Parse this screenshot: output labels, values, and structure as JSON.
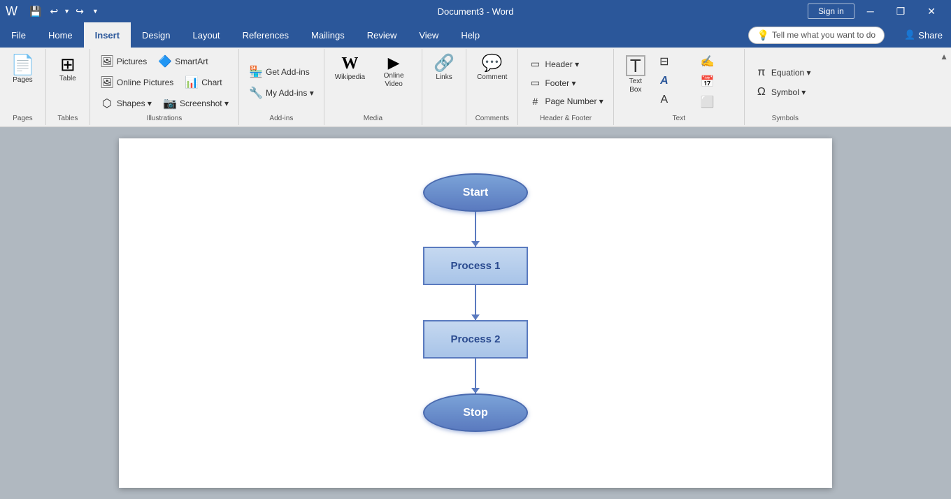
{
  "titleBar": {
    "documentName": "Document3 - Word",
    "signInLabel": "Sign in"
  },
  "quickAccess": {
    "save": "💾",
    "undo": "↩",
    "undoArrow": "▼",
    "redo": "↪",
    "customize": "▼"
  },
  "windowControls": {
    "minimize": "─",
    "restore": "❐",
    "close": "✕"
  },
  "tabs": [
    {
      "id": "file",
      "label": "File",
      "active": false
    },
    {
      "id": "home",
      "label": "Home",
      "active": false
    },
    {
      "id": "insert",
      "label": "Insert",
      "active": true
    },
    {
      "id": "design",
      "label": "Design",
      "active": false
    },
    {
      "id": "layout",
      "label": "Layout",
      "active": false
    },
    {
      "id": "references",
      "label": "References",
      "active": false
    },
    {
      "id": "mailings",
      "label": "Mailings",
      "active": false
    },
    {
      "id": "review",
      "label": "Review",
      "active": false
    },
    {
      "id": "view",
      "label": "View",
      "active": false
    },
    {
      "id": "help",
      "label": "Help",
      "active": false
    }
  ],
  "tellMe": {
    "placeholder": "Tell me what you want to do",
    "icon": "💡"
  },
  "share": {
    "label": "Share",
    "icon": "👤"
  },
  "ribbon": {
    "groups": [
      {
        "id": "pages",
        "label": "Pages",
        "items": [
          {
            "id": "pages-btn",
            "type": "large",
            "icon": "📄",
            "label": "Pages"
          }
        ]
      },
      {
        "id": "tables",
        "label": "Tables",
        "items": [
          {
            "id": "table-btn",
            "type": "large",
            "icon": "⊞",
            "label": "Table"
          }
        ]
      },
      {
        "id": "illustrations",
        "label": "Illustrations",
        "items": [
          {
            "id": "pictures-btn",
            "type": "small",
            "icon": "🖼",
            "label": "Pictures"
          },
          {
            "id": "online-pictures-btn",
            "type": "small",
            "icon": "🖼",
            "label": "Online Pictures"
          },
          {
            "id": "shapes-btn",
            "type": "small",
            "icon": "⬡",
            "label": "Shapes"
          },
          {
            "id": "smartart-btn",
            "type": "small",
            "icon": "📊",
            "label": "SmartArt"
          },
          {
            "id": "chart-btn",
            "type": "small",
            "icon": "📊",
            "label": "Chart"
          },
          {
            "id": "screenshot-btn",
            "type": "small",
            "icon": "📷",
            "label": "Screenshot"
          }
        ]
      },
      {
        "id": "addins",
        "label": "Add-ins",
        "items": [
          {
            "id": "get-addins-btn",
            "type": "small",
            "icon": "🏪",
            "label": "Get Add-ins"
          },
          {
            "id": "my-addins-btn",
            "type": "small",
            "icon": "🔧",
            "label": "My Add-ins"
          }
        ]
      },
      {
        "id": "media",
        "label": "Media",
        "items": [
          {
            "id": "wikipedia-btn",
            "type": "large",
            "icon": "W",
            "label": "Wikipedia"
          },
          {
            "id": "online-video-btn",
            "type": "large",
            "icon": "▶",
            "label": "Online\nVideo"
          }
        ]
      },
      {
        "id": "links",
        "label": "",
        "items": [
          {
            "id": "links-btn",
            "type": "large",
            "icon": "🔗",
            "label": "Links"
          }
        ]
      },
      {
        "id": "comments",
        "label": "Comments",
        "items": [
          {
            "id": "comment-btn",
            "type": "large",
            "icon": "💬",
            "label": "Comment"
          }
        ]
      },
      {
        "id": "header-footer",
        "label": "Header & Footer",
        "items": [
          {
            "id": "header-btn",
            "type": "small",
            "icon": "▭",
            "label": "Header"
          },
          {
            "id": "footer-btn",
            "type": "small",
            "icon": "▭",
            "label": "Footer"
          },
          {
            "id": "page-number-btn",
            "type": "small",
            "icon": "#",
            "label": "Page Number"
          }
        ]
      },
      {
        "id": "text",
        "label": "Text",
        "items": [
          {
            "id": "textbox-btn",
            "type": "large",
            "icon": "T",
            "label": "Text\nBox"
          },
          {
            "id": "quick-parts-btn",
            "type": "small",
            "icon": "⊟",
            "label": ""
          },
          {
            "id": "wordart-btn",
            "type": "small",
            "icon": "A",
            "label": ""
          },
          {
            "id": "dropcap-btn",
            "type": "small",
            "icon": "A",
            "label": ""
          },
          {
            "id": "signline-btn",
            "type": "small",
            "icon": "✍",
            "label": ""
          },
          {
            "id": "datetime-btn",
            "type": "small",
            "icon": "📅",
            "label": ""
          },
          {
            "id": "obj-btn",
            "type": "small",
            "icon": "⬜",
            "label": ""
          }
        ]
      },
      {
        "id": "symbols",
        "label": "Symbols",
        "items": [
          {
            "id": "equation-btn",
            "type": "small",
            "icon": "π",
            "label": "Equation"
          },
          {
            "id": "symbol-btn",
            "type": "small",
            "icon": "Ω",
            "label": "Symbol"
          }
        ]
      }
    ]
  },
  "flowchart": {
    "start": "Start",
    "process1": "Process 1",
    "process2": "Process 2",
    "stop": "Stop"
  }
}
